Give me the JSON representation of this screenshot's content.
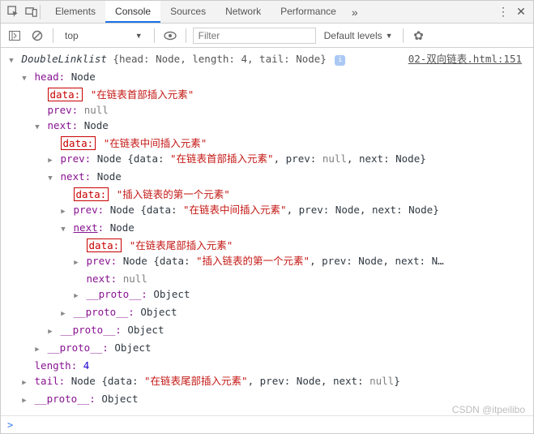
{
  "tabs": {
    "items": [
      "Elements",
      "Console",
      "Sources",
      "Network",
      "Performance"
    ],
    "active_index": 1
  },
  "toolbar": {
    "context": "top",
    "filter_placeholder": "Filter",
    "levels_label": "Default levels"
  },
  "source_link": "02-双向链表.html:151",
  "log": {
    "class_name": "DoubleLinklist",
    "summary": "{head: Node, length: 4, tail: Node}",
    "head": {
      "label": "head",
      "type": "Node",
      "data": "\"在链表首部插入元素\"",
      "prev": "null",
      "next": {
        "label": "next",
        "type": "Node",
        "data": "\"在链表中间插入元素\"",
        "prev_summary": "Node {data: \"在链表首部插入元素\", prev: null, next: Node}",
        "next": {
          "label": "next",
          "type": "Node",
          "data": "\"插入链表的第一个元素\"",
          "prev_summary": "Node {data: \"在链表中间插入元素\", prev: Node, next: Node}",
          "next": {
            "label": "next",
            "type": "Node",
            "data": "\"在链表尾部插入元素\"",
            "prev_summary": "Node {data: \"插入链表的第一个元素\", prev: Node, next: N…",
            "next_value": "null",
            "proto": "Object"
          },
          "proto": "Object"
        },
        "proto": "Object"
      },
      "proto": "Object"
    },
    "length_label": "length",
    "length_value": "4",
    "tail_label": "tail",
    "tail_summary": "Node {data: \"在链表尾部插入元素\", prev: Node, next: null}",
    "proto": "Object"
  },
  "prompt": ">",
  "watermark": "CSDN @itpeilibo",
  "labels": {
    "data": "data:",
    "prev": "prev",
    "next": "next",
    "proto": "__proto__",
    "node": "Node"
  }
}
